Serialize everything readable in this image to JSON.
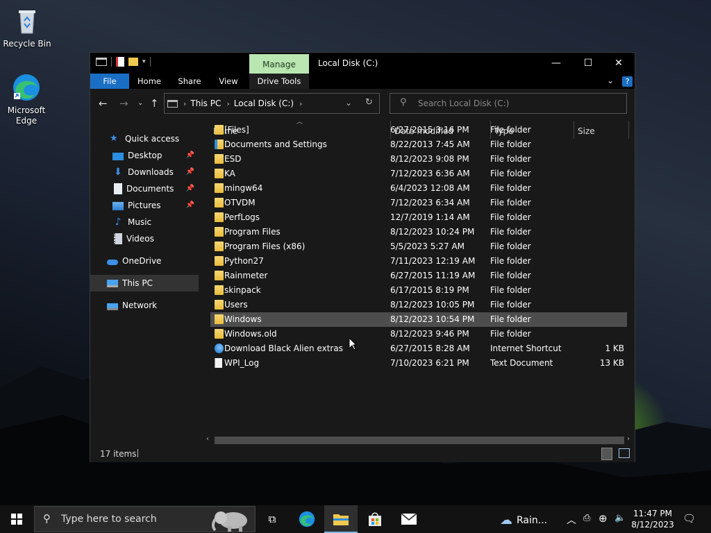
{
  "desktop": {
    "icons": [
      {
        "label": "Recycle Bin"
      },
      {
        "label": "Microsoft Edge"
      }
    ]
  },
  "window": {
    "title": "Local Disk (C:)",
    "manage_tab": "Manage",
    "controls": {
      "minimize": "—",
      "maximize": "☐",
      "close": "✕"
    },
    "ribbon_tabs": [
      "File",
      "Home",
      "Share",
      "View",
      "Drive Tools"
    ],
    "address": {
      "parts": [
        "This PC",
        "Local Disk (C:)"
      ]
    },
    "search": {
      "placeholder": "Search Local Disk (C:)"
    },
    "sidebar": {
      "items": [
        {
          "label": "Quick access",
          "icon": "star-icon"
        },
        {
          "label": "Desktop",
          "icon": "desktop-icon",
          "pinned": true
        },
        {
          "label": "Downloads",
          "icon": "download-icon",
          "pinned": true
        },
        {
          "label": "Documents",
          "icon": "document-icon",
          "pinned": true
        },
        {
          "label": "Pictures",
          "icon": "picture-icon",
          "pinned": true
        },
        {
          "label": "Music",
          "icon": "music-icon"
        },
        {
          "label": "Videos",
          "icon": "video-icon"
        },
        {
          "label": "OneDrive",
          "icon": "cloud-icon"
        },
        {
          "label": "This PC",
          "icon": "computer-icon",
          "selected": true
        },
        {
          "label": "Network",
          "icon": "network-icon"
        }
      ]
    },
    "columns": [
      "Name",
      "Date modified",
      "Type",
      "Size"
    ],
    "files": [
      {
        "name": "[Files]",
        "date": "6/27/2015 3:16 PM",
        "type": "File folder",
        "size": "",
        "kind": "folder"
      },
      {
        "name": "Documents and Settings",
        "date": "8/22/2013 7:45 AM",
        "type": "File folder",
        "size": "",
        "kind": "folder-link"
      },
      {
        "name": "ESD",
        "date": "8/12/2023 9:08 PM",
        "type": "File folder",
        "size": "",
        "kind": "folder"
      },
      {
        "name": "KA",
        "date": "7/12/2023 6:36 AM",
        "type": "File folder",
        "size": "",
        "kind": "folder"
      },
      {
        "name": "mingw64",
        "date": "6/4/2023 12:08 AM",
        "type": "File folder",
        "size": "",
        "kind": "folder"
      },
      {
        "name": "OTVDM",
        "date": "7/12/2023 6:34 AM",
        "type": "File folder",
        "size": "",
        "kind": "folder"
      },
      {
        "name": "PerfLogs",
        "date": "12/7/2019 1:14 AM",
        "type": "File folder",
        "size": "",
        "kind": "folder"
      },
      {
        "name": "Program Files",
        "date": "8/12/2023 10:24 PM",
        "type": "File folder",
        "size": "",
        "kind": "folder"
      },
      {
        "name": "Program Files (x86)",
        "date": "5/5/2023 5:27 AM",
        "type": "File folder",
        "size": "",
        "kind": "folder"
      },
      {
        "name": "Python27",
        "date": "7/11/2023 12:19 AM",
        "type": "File folder",
        "size": "",
        "kind": "folder"
      },
      {
        "name": "Rainmeter",
        "date": "6/27/2015 11:19 AM",
        "type": "File folder",
        "size": "",
        "kind": "folder"
      },
      {
        "name": "skinpack",
        "date": "6/17/2015 8:19 PM",
        "type": "File folder",
        "size": "",
        "kind": "folder"
      },
      {
        "name": "Users",
        "date": "8/12/2023 10:05 PM",
        "type": "File folder",
        "size": "",
        "kind": "folder"
      },
      {
        "name": "Windows",
        "date": "8/12/2023 10:54 PM",
        "type": "File folder",
        "size": "",
        "kind": "folder",
        "highlighted": true
      },
      {
        "name": "Windows.old",
        "date": "8/12/2023 9:46 PM",
        "type": "File folder",
        "size": "",
        "kind": "folder"
      },
      {
        "name": "Download Black Alien extras",
        "date": "6/27/2015 8:28 AM",
        "type": "Internet Shortcut",
        "size": "1 KB",
        "kind": "shortcut"
      },
      {
        "name": "WPI_Log",
        "date": "7/10/2023 6:21 PM",
        "type": "Text Document",
        "size": "13 KB",
        "kind": "text"
      }
    ],
    "status": {
      "items": "17 items"
    }
  },
  "taskbar": {
    "search_placeholder": "Type here to search",
    "weather": "Rain...",
    "time": "11:47 PM",
    "date": "8/12/2023"
  },
  "colors": {
    "accent": "#1a6fc4",
    "manage_tab": "#b9e6b1",
    "folder": "#f0c94f"
  }
}
